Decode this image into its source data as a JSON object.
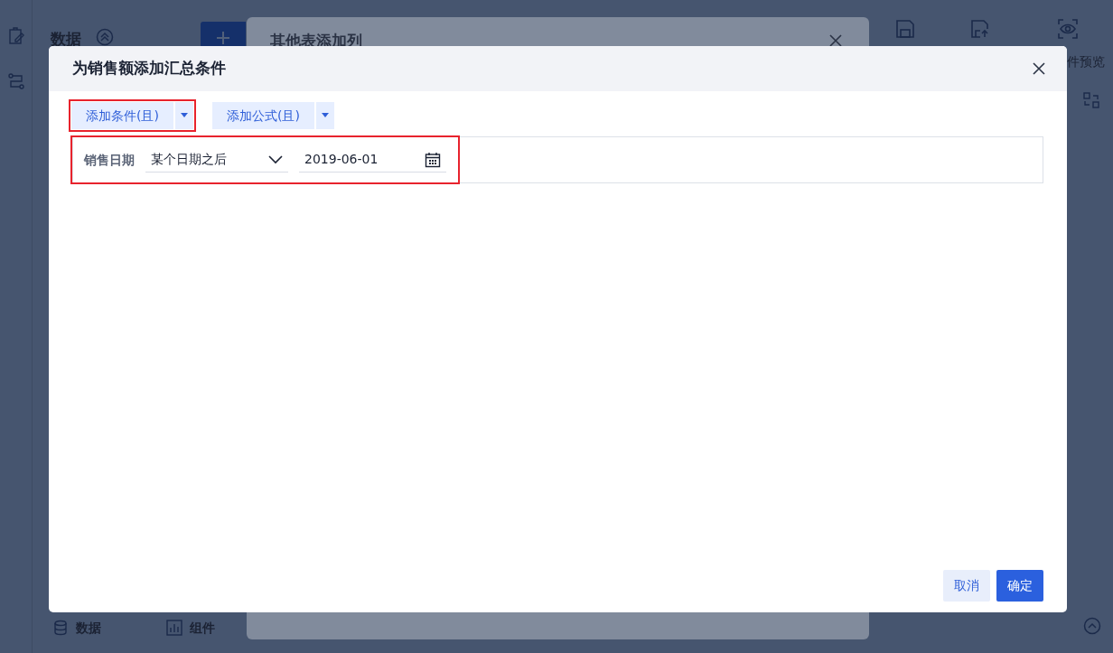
{
  "background": {
    "panel_title": "数据",
    "toolbar_label": "件预览",
    "bottom_tabs": [
      {
        "label": "数据",
        "kind": "data"
      },
      {
        "label": "组件",
        "kind": "widget"
      }
    ]
  },
  "back_dialog": {
    "title": "其他表添加列"
  },
  "dialog": {
    "title": "为销售额添加汇总条件",
    "actions": [
      {
        "label": "添加条件(且)",
        "highlighted": true
      },
      {
        "label": "添加公式(且)",
        "highlighted": false
      }
    ],
    "condition": {
      "field": "销售日期",
      "operator": "某个日期之后",
      "value": "2019-06-01",
      "highlighted": true
    },
    "buttons": [
      {
        "label": "取消",
        "kind": "secondary"
      },
      {
        "label": "确定",
        "kind": "primary"
      }
    ]
  }
}
